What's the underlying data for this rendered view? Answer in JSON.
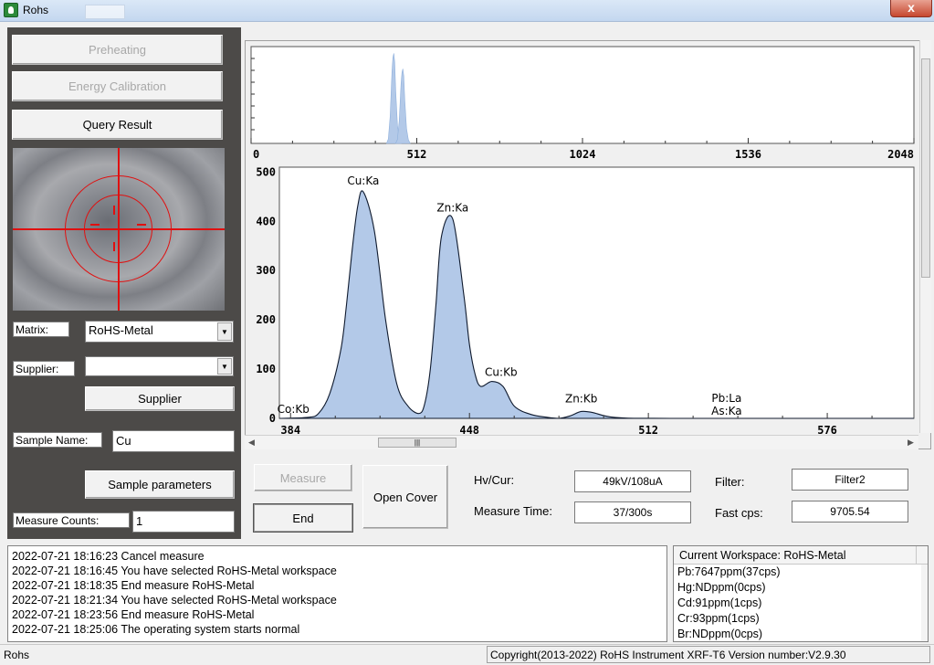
{
  "window": {
    "title": "Rohs",
    "close_glyph": "x"
  },
  "left": {
    "preheating_label": "Preheating",
    "energy_calibration_label": "Energy Calibration",
    "query_result_label": "Query Result",
    "matrix_label": "Matrix:",
    "matrix_value": "RoHS-Metal",
    "supplier_label": "Supplier:",
    "supplier_value": "",
    "supplier_button": "Supplier",
    "sample_name_label": "Sample Name:",
    "sample_name_value": "Cu",
    "sample_params_button": "Sample parameters",
    "measure_counts_label": "Measure Counts:",
    "measure_counts_value": "1"
  },
  "chart_data": [
    {
      "type": "line",
      "name": "overview-spectrum",
      "x_ticks": [
        "0",
        "512",
        "1024",
        "1536",
        "2048"
      ],
      "xlim": [
        0,
        2048
      ],
      "peaks": [
        {
          "x": 441,
          "height": 0.93
        },
        {
          "x": 469,
          "height": 0.77
        }
      ]
    },
    {
      "type": "area",
      "name": "zoom-spectrum",
      "x_ticks": [
        "384",
        "448",
        "512",
        "576"
      ],
      "y_ticks": [
        "500",
        "400",
        "300",
        "200",
        "100",
        "0"
      ],
      "xlim": [
        380,
        607
      ],
      "ylim": [
        0,
        510
      ],
      "x": [
        380,
        390,
        394,
        398,
        402,
        404,
        406,
        408,
        410,
        414,
        418,
        422,
        426,
        430,
        432,
        434,
        436,
        438,
        442,
        446,
        448,
        450,
        452,
        456,
        460,
        464,
        470,
        476,
        480,
        484,
        488,
        492,
        500,
        520,
        607
      ],
      "y": [
        0,
        2,
        10,
        50,
        140,
        230,
        340,
        430,
        460,
        380,
        200,
        70,
        25,
        10,
        30,
        100,
        230,
        370,
        405,
        250,
        150,
        90,
        65,
        75,
        65,
        25,
        8,
        2,
        0,
        5,
        14,
        12,
        2,
        0,
        0
      ],
      "annotations": [
        {
          "text": "Cu:Ka",
          "x": 410,
          "y": 460
        },
        {
          "text": "Zn:Ka",
          "x": 442,
          "y": 405
        },
        {
          "text": "Cu:Kb",
          "x": 458,
          "y": 75
        },
        {
          "text": "Co:Kb",
          "x": 385,
          "y": 0
        },
        {
          "text": "Zn:Kb",
          "x": 488,
          "y": 14
        },
        {
          "text": "Pb:La",
          "x": 540,
          "y": 0
        },
        {
          "text": "As:Ka",
          "x": 540,
          "y": 0
        }
      ]
    }
  ],
  "controls": {
    "measure_label": "Measure",
    "end_label": "End",
    "open_cover_label": "Open Cover",
    "hv_label": "Hv/Cur:",
    "hv_value": "49kV/108uA",
    "filter_label": "Filter:",
    "filter_value": "Filter2",
    "measure_time_label": "Measure Time:",
    "measure_time_value": "37/300s",
    "fast_cps_label": "Fast cps:",
    "fast_cps_value": "9705.54"
  },
  "log": [
    "2022-07-21 18:16:23 Cancel measure",
    "2022-07-21 18:16:45 You have selected RoHS-Metal workspace",
    "2022-07-21 18:18:35 End measure RoHS-Metal",
    "2022-07-21 18:21:34 You have selected RoHS-Metal workspace",
    "2022-07-21 18:23:56 End measure RoHS-Metal",
    "2022-07-21 18:25:06 The operating system starts normal"
  ],
  "workspace": {
    "header": "Current Workspace: RoHS-Metal",
    "items": [
      "Pb:7647ppm(37cps)",
      "Hg:NDppm(0cps)",
      "Cd:91ppm(1cps)",
      "Cr:93ppm(1cps)",
      "Br:NDppm(0cps)"
    ]
  },
  "status": {
    "left": "Rohs",
    "right": "Copyright(2013-2022) RoHS Instrument XRF-T6 Version number:V2.9.30"
  },
  "colors": {
    "spectrum_fill": "#b3c9e8",
    "spectrum_stroke": "#0f1a2e",
    "crosshair": "#e01010",
    "panel_bg": "#4c4a48"
  }
}
